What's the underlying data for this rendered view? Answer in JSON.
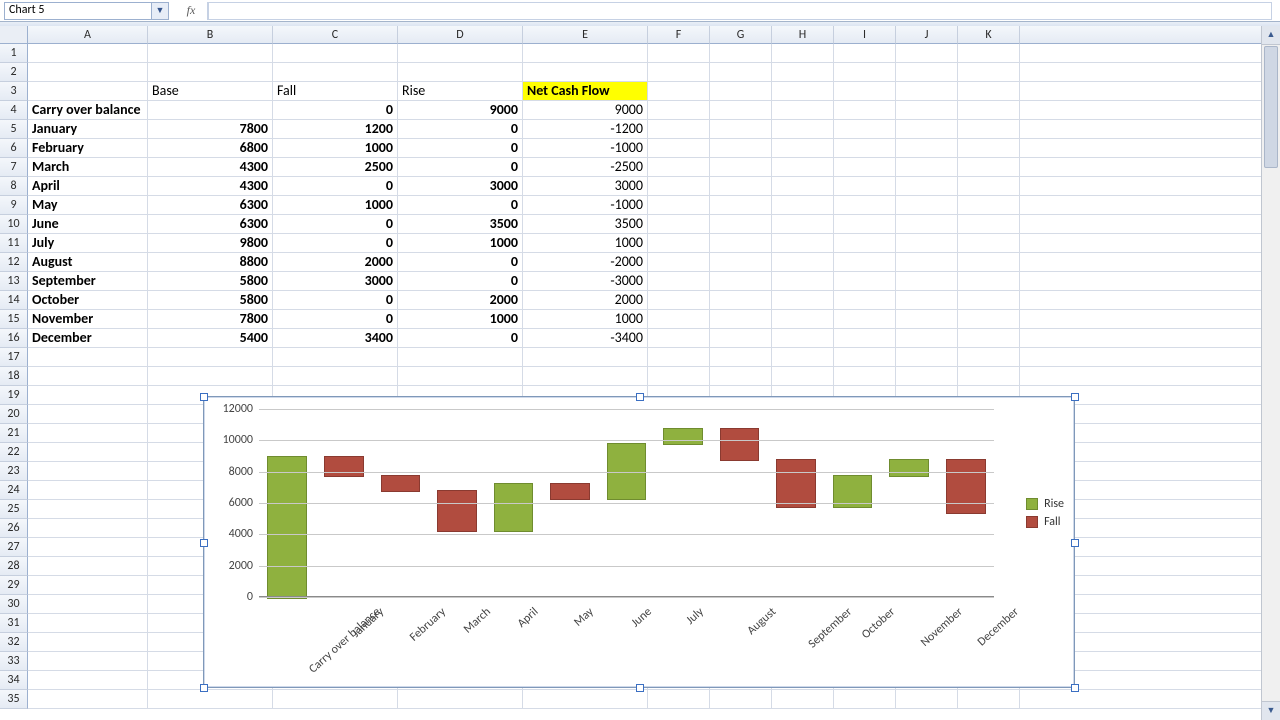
{
  "formula_bar": {
    "name_box_value": "Chart 5",
    "fx_label": "fx",
    "formula_value": ""
  },
  "columns": {
    "letters": [
      "A",
      "B",
      "C",
      "D",
      "E",
      "F",
      "G",
      "H",
      "I",
      "J",
      "K"
    ],
    "widths": [
      120,
      125,
      125,
      125,
      125,
      62,
      62,
      62,
      62,
      62,
      62
    ]
  },
  "row_count": 35,
  "table": {
    "header_row": 3,
    "headers": {
      "B": "Base",
      "C": "Fall",
      "D": "Rise",
      "E": "Net Cash Flow"
    },
    "highlight_header_col": "E",
    "rows": [
      {
        "r": 4,
        "label": "Carry over balance",
        "base": "",
        "fall": 0,
        "rise": 9000,
        "net": 9000
      },
      {
        "r": 5,
        "label": "January",
        "base": 7800,
        "fall": 1200,
        "rise": 0,
        "net": -1200
      },
      {
        "r": 6,
        "label": "February",
        "base": 6800,
        "fall": 1000,
        "rise": 0,
        "net": -1000
      },
      {
        "r": 7,
        "label": "March",
        "base": 4300,
        "fall": 2500,
        "rise": 0,
        "net": -2500
      },
      {
        "r": 8,
        "label": "April",
        "base": 4300,
        "fall": 0,
        "rise": 3000,
        "net": 3000
      },
      {
        "r": 9,
        "label": "May",
        "base": 6300,
        "fall": 1000,
        "rise": 0,
        "net": -1000
      },
      {
        "r": 10,
        "label": "June",
        "base": 6300,
        "fall": 0,
        "rise": 3500,
        "net": 3500
      },
      {
        "r": 11,
        "label": "July",
        "base": 9800,
        "fall": 0,
        "rise": 1000,
        "net": 1000
      },
      {
        "r": 12,
        "label": "August",
        "base": 8800,
        "fall": 2000,
        "rise": 0,
        "net": -2000
      },
      {
        "r": 13,
        "label": "September",
        "base": 5800,
        "fall": 3000,
        "rise": 0,
        "net": -3000
      },
      {
        "r": 14,
        "label": "October",
        "base": 5800,
        "fall": 0,
        "rise": 2000,
        "net": 2000
      },
      {
        "r": 15,
        "label": "November",
        "base": 7800,
        "fall": 0,
        "rise": 1000,
        "net": 1000
      },
      {
        "r": 16,
        "label": "December",
        "base": 5400,
        "fall": 3400,
        "rise": 0,
        "net": -3400
      }
    ]
  },
  "legend": {
    "rise": "Rise",
    "fall": "Fall"
  },
  "chart_data": {
    "type": "bar",
    "title": "",
    "xlabel": "",
    "ylabel": "",
    "ylim": [
      0,
      12000
    ],
    "yticks": [
      0,
      2000,
      4000,
      6000,
      8000,
      10000,
      12000
    ],
    "categories": [
      "Carry over balance",
      "January",
      "February",
      "March",
      "April",
      "May",
      "June",
      "July",
      "August",
      "September",
      "October",
      "November",
      "December"
    ],
    "series": [
      {
        "name": "Base",
        "role": "invisible",
        "values": [
          0,
          7800,
          6800,
          4300,
          4300,
          6300,
          6300,
          9800,
          8800,
          5800,
          5800,
          7800,
          5400
        ]
      },
      {
        "name": "Fall",
        "color": "#b14c3f",
        "values": [
          0,
          1200,
          1000,
          2500,
          0,
          1000,
          0,
          0,
          2000,
          3000,
          0,
          0,
          3400
        ]
      },
      {
        "name": "Rise",
        "color": "#8fb13f",
        "values": [
          9000,
          0,
          0,
          0,
          3000,
          0,
          3500,
          1000,
          0,
          0,
          2000,
          1000,
          0
        ]
      }
    ],
    "legend_position": "right"
  }
}
